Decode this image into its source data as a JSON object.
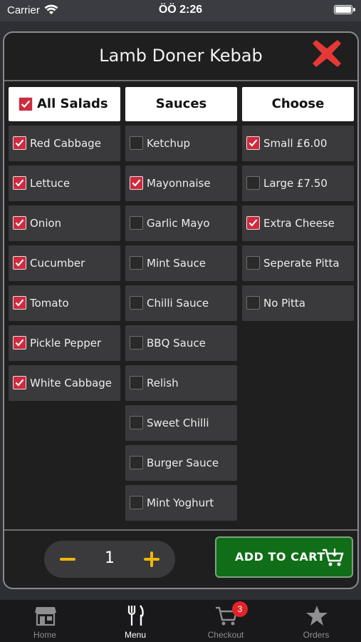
{
  "status_bar": {
    "carrier": "Carrier",
    "time": "ÖÖ 2:26"
  },
  "modal": {
    "title": "Lamb Doner Kebab",
    "columns": [
      {
        "header": "All Salads",
        "header_checked": true,
        "options": [
          {
            "label": "Red Cabbage",
            "checked": true
          },
          {
            "label": "Lettuce",
            "checked": true
          },
          {
            "label": "Onion",
            "checked": true
          },
          {
            "label": "Cucumber",
            "checked": true
          },
          {
            "label": "Tomato",
            "checked": true
          },
          {
            "label": "Pickle Pepper",
            "checked": true
          },
          {
            "label": "White Cabbage",
            "checked": true
          }
        ]
      },
      {
        "header": "Sauces",
        "options": [
          {
            "label": "Ketchup",
            "checked": false
          },
          {
            "label": "Mayonnaise",
            "checked": true
          },
          {
            "label": "Garlic Mayo",
            "checked": false
          },
          {
            "label": "Mint Sauce",
            "checked": false
          },
          {
            "label": "Chilli Sauce",
            "checked": false
          },
          {
            "label": "BBQ Sauce",
            "checked": false
          },
          {
            "label": "Relish",
            "checked": false
          },
          {
            "label": "Sweet Chilli",
            "checked": false
          },
          {
            "label": "Burger Sauce",
            "checked": false
          },
          {
            "label": "Mint Yoghurt",
            "checked": false
          }
        ]
      },
      {
        "header": "Choose",
        "options": [
          {
            "label": "Small £6.00",
            "checked": true
          },
          {
            "label": "Large £7.50",
            "checked": false
          },
          {
            "label": "Extra Cheese",
            "checked": true
          },
          {
            "label": "Seperate Pitta",
            "checked": false
          },
          {
            "label": "No Pitta",
            "checked": false
          }
        ]
      }
    ],
    "quantity": "1",
    "add_to_cart_label": "ADD TO CART"
  },
  "tabs": [
    {
      "label": "Home",
      "icon": "store-icon",
      "active": false
    },
    {
      "label": "Menu",
      "icon": "fork-knife-icon",
      "active": true
    },
    {
      "label": "Checkout",
      "icon": "cart-icon",
      "active": false,
      "badge": "3"
    },
    {
      "label": "Orders",
      "icon": "star-icon",
      "active": false
    }
  ],
  "colors": {
    "check_red": "#d02a3e",
    "qty_accent": "#f2b705",
    "cart_green": "#0f6e17",
    "close_red": "#e53935",
    "badge_red": "#e0242c"
  }
}
